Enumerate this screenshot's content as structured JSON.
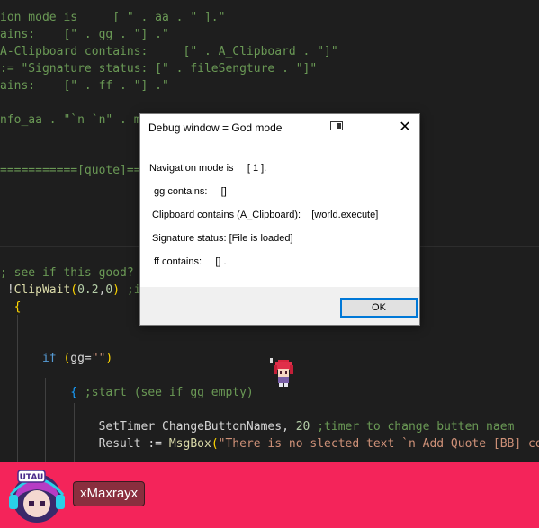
{
  "editor": {
    "lines": [
      {
        "segments": [
          {
            "cls": "green",
            "text": "ion mode is     [ \" . aa . \" ].\""
          }
        ]
      },
      {
        "segments": [
          {
            "cls": "green",
            "text": "ains:    [\" . gg . \"] .\""
          }
        ]
      },
      {
        "segments": [
          {
            "cls": "green",
            "text": "A-Clipboard contains:     [\" . A_Clipboard . \"]\""
          }
        ]
      },
      {
        "segments": [
          {
            "cls": "green",
            "text": ":= \"Signature status: [\" . fileSengture . \"]\""
          }
        ]
      },
      {
        "segments": [
          {
            "cls": "green",
            "text": "ains:    [\" . ff . \"] .\""
          }
        ]
      },
      {
        "segments": [
          {
            "cls": "green",
            "text": "nfo_aa . \"`n `n\" . m"
          }
        ]
      },
      {
        "segments": [
          {
            "cls": "green",
            "text": "===========[quote]==="
          }
        ]
      },
      {
        "segments": [
          {
            "cls": "green",
            "text": "; see if this good?"
          }
        ]
      },
      {
        "segments": [
          {
            "cls": "white",
            "text": " !"
          },
          {
            "cls": "yellow",
            "text": "ClipWait"
          },
          {
            "cls": "brace-gold",
            "text": "("
          },
          {
            "cls": "num",
            "text": "0.2"
          },
          {
            "cls": "white",
            "text": ","
          },
          {
            "cls": "num",
            "text": "0"
          },
          {
            "cls": "brace-gold",
            "text": ")"
          },
          {
            "cls": "green",
            "text": " ;i"
          }
        ]
      },
      {
        "segments": [
          {
            "cls": "brace-gold",
            "text": "  {"
          }
        ]
      },
      {
        "segments": [
          {
            "cls": "blue",
            "text": "      if "
          },
          {
            "cls": "brace-gold",
            "text": "("
          },
          {
            "cls": "white",
            "text": "gg="
          },
          {
            "cls": "orange",
            "text": "\"\""
          },
          {
            "cls": "brace-gold",
            "text": ")"
          }
        ]
      },
      {
        "segments": [
          {
            "cls": "brace-blue",
            "text": "          {"
          },
          {
            "cls": "green",
            "text": " ;start (see if gg empty)"
          }
        ]
      },
      {
        "segments": [
          {
            "cls": "white",
            "text": "              SetTimer ChangeButtonNames, "
          },
          {
            "cls": "num",
            "text": "20"
          },
          {
            "cls": "green",
            "text": " ;timer to change butten naem"
          }
        ]
      },
      {
        "segments": [
          {
            "cls": "white",
            "text": "              Result := "
          },
          {
            "cls": "yellow",
            "text": "MsgBox"
          },
          {
            "cls": "brace-gold",
            "text": "("
          },
          {
            "cls": "orange",
            "text": "\"There is no slected text `n Add Quote [BB] cod"
          }
        ]
      }
    ]
  },
  "dialog": {
    "title": "Debug window = God mode",
    "navigation": "Navigation mode is     [ 1 ].",
    "gg": " gg contains:     []",
    "clipboard": "Clipboard contains (A_Clipboard):    [world.execute]",
    "signature": "Signature status: [File is loaded]",
    "ff": " ff contains:     [] .",
    "ok_label": "OK",
    "close_glyph": "✕"
  },
  "footer": {
    "username": "xMaxrayx",
    "avatar_text": "UTAU"
  },
  "colors": {
    "footer_bg": "#f4245a",
    "editor_bg": "#1e1e1e",
    "ok_border": "#0078d7"
  }
}
